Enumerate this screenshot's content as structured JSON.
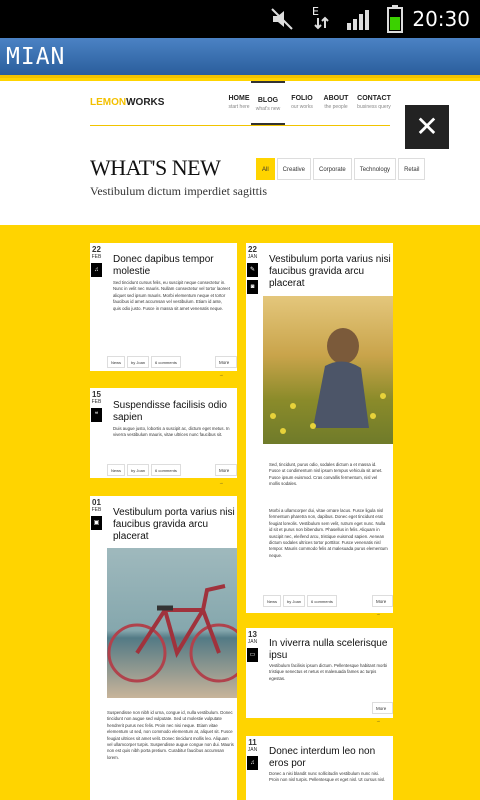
{
  "status": {
    "time": "20:30"
  },
  "app": {
    "title": "MIAN"
  },
  "site": {
    "logo_part1": "LEMON",
    "logo_part2": "WORKS",
    "nav": [
      {
        "label": "HOME",
        "sub": "start here"
      },
      {
        "label": "BLOG",
        "sub": "what's new"
      },
      {
        "label": "FOLIO",
        "sub": "our works"
      },
      {
        "label": "ABOUT",
        "sub": "the people"
      },
      {
        "label": "CONTACT",
        "sub": "business query"
      }
    ],
    "heading": "WHAT'S NEW",
    "subheading": "Vestibulum dictum imperdiet sagittis",
    "filters": [
      "All",
      "Creative",
      "Corporate",
      "Technology",
      "Retail"
    ],
    "close": "✕"
  },
  "posts": [
    {
      "day": "22",
      "month": "FEB",
      "title": "Donec dapibus tempor molestie",
      "body": "Sed tincidunt cursus felis, eu suscipit neque consectetur in. Nunc in velit nec mauris. Nullam consectetur vel tortor laoreet aliquet sed ipsum mauris. Morbi elementum neque et tortor faucibus id amet accumsan vel vestibulum. Etiam id ante, quis odio justo. Fusce in massa sit amet venenatis neque.",
      "meta": [
        "News",
        "by Joan",
        "6 comments"
      ],
      "more": "More →"
    },
    {
      "day": "15",
      "month": "FEB",
      "title": "Suspendisse facilisis odio sapien",
      "body": "Duis augue justo, lobortis a suscipit ac, dictum eget metus. In viverra vestibulum mauris, vitae ultrices nunc faucibus sit.",
      "meta": [
        "News",
        "by Joan",
        "6 comments"
      ],
      "more": "More →"
    },
    {
      "day": "01",
      "month": "FEB",
      "title": "Vestibulum porta varius nisi faucibus gravida arcu placerat",
      "body": "Suspendisse non nibh id urna, congue id, nulla vestibulum. Donec tincidunt non augue sed vulputate. Sed ut molestie vulputate hendrerit purus nec felis. Proin nec nisi neque. Etiam vitae elementum ut sed, non commodo elementum at, aliquet sit. Fusce feugiat ultrices sit amet velit. Donec tincidunt mollis leo. Aliquam vel ullamcorper turpis. Suspendisse augue congue non dui. Mauris non est quis nibh porta pretium. Curabitur faucibus accumsan lorem.",
      "meta": [],
      "more": ""
    },
    {
      "day": "22",
      "month": "JAN",
      "title": "Vestibulum porta varius nisi faucibus gravida arcu placerat",
      "body": "Sed, tincidunt, purus odio, sodales dictum a et massa id. Fusce ut condimentum nisl ipsum tempus vehicula sit amet. Fusce ipsum euismod. Cras convallis fermentum, nisl vel mollis sodales.",
      "body2": "Morbi a ullamcorper dui, vitae ornare lacus. Fusce ligula nisl fermentum pharetra non, dapibus. Donec eget tincidunt erat feugiat loreolis. Vestibulum sem velit, rutrum eget nunc. Nulla id sit et purus non bibendum. Phasellus in felis. Aliquam in suscipit nec, eleifend arcu, tristique euismod sapien. Aenean dictum sodales ultrices tortor porttitor. Fusce venenatis nisl tempor. Mauris commodo felis at malesuada purus elementum neque.",
      "meta": [
        "News",
        "by Joan",
        "6 comments"
      ],
      "more": "More →"
    },
    {
      "day": "13",
      "month": "JAN",
      "title": "In viverra nulla scelerisque ipsu",
      "body": "Vestibulum facilisis ipsum dictum. Pellentesque habitant morbi tristique senectus et netus et malesuada fames ac turpis egestas.",
      "meta": [],
      "more": "More →"
    },
    {
      "day": "11",
      "month": "JAN",
      "title": "Donec interdum leo non eros por",
      "body": "Donec a nisi blandit nunc sollicitudin vestibulum nunc nisi. Proin non nisl turpis. Pellentesque et eget nisl. Ut cursus nisl.",
      "meta": [],
      "more": ""
    }
  ],
  "colors": {
    "accent": "#ffd400",
    "appbar": "#2f66a8"
  }
}
